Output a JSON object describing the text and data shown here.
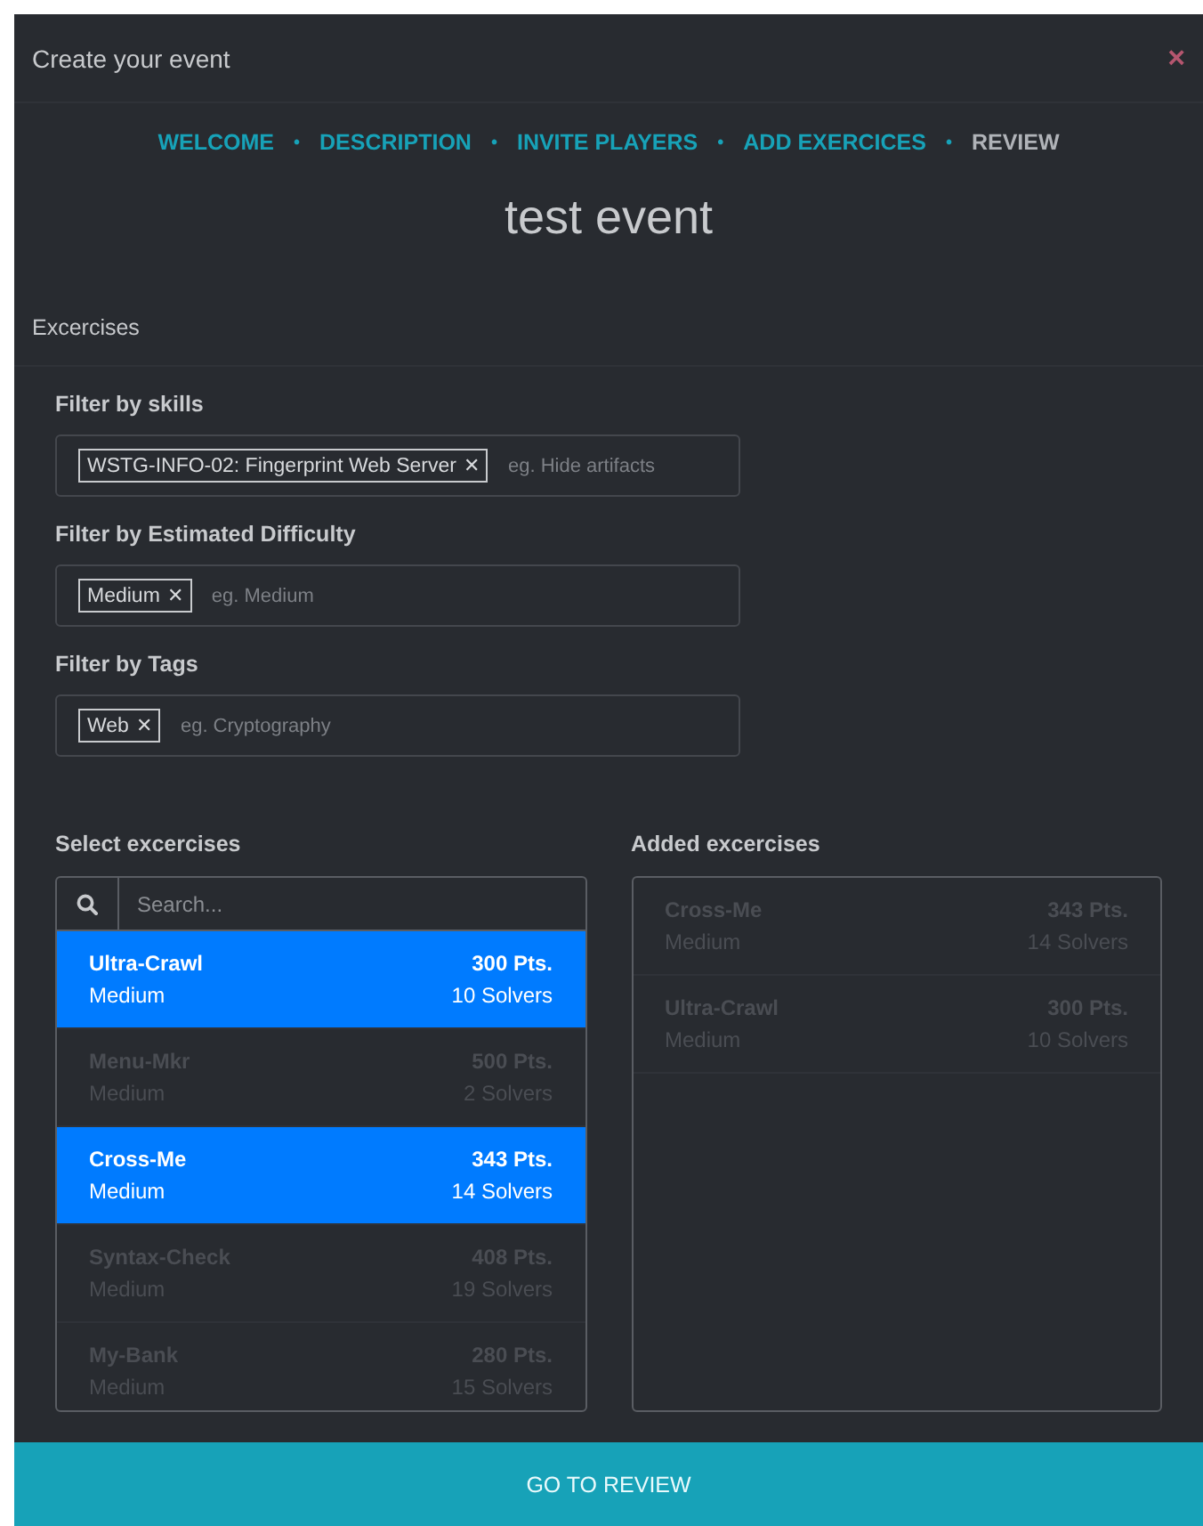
{
  "modal": {
    "title": "Create your event",
    "close": "×"
  },
  "steps": [
    {
      "label": "WELCOME",
      "enabled": true
    },
    {
      "label": "DESCRIPTION",
      "enabled": true
    },
    {
      "label": "INVITE PLAYERS",
      "enabled": true
    },
    {
      "label": "ADD EXERCICES",
      "enabled": true
    },
    {
      "label": "REVIEW",
      "enabled": false
    }
  ],
  "step_separator": "•",
  "event_name": "test event",
  "section_title": "Excercises",
  "filters": [
    {
      "label": "Filter by skills",
      "tags": [
        "WSTG-INFO-02: Fingerprint Web Server"
      ],
      "placeholder": "eg. Hide artifacts"
    },
    {
      "label": "Filter by Estimated Difficulty",
      "tags": [
        "Medium"
      ],
      "placeholder": "eg. Medium"
    },
    {
      "label": "Filter by Tags",
      "tags": [
        "Web"
      ],
      "placeholder": "eg. Cryptography"
    }
  ],
  "tag_remove": "✕",
  "select_list": {
    "label": "Select excercises",
    "search_placeholder": "Search...",
    "items": [
      {
        "name": "Ultra-Crawl",
        "points": "300 Pts.",
        "difficulty": "Medium",
        "solvers": "10 Solvers",
        "selected": true
      },
      {
        "name": "Menu-Mkr",
        "points": "500 Pts.",
        "difficulty": "Medium",
        "solvers": "2 Solvers",
        "selected": false
      },
      {
        "name": "Cross-Me",
        "points": "343 Pts.",
        "difficulty": "Medium",
        "solvers": "14 Solvers",
        "selected": true
      },
      {
        "name": "Syntax-Check",
        "points": "408 Pts.",
        "difficulty": "Medium",
        "solvers": "19 Solvers",
        "selected": false
      },
      {
        "name": "My-Bank",
        "points": "280 Pts.",
        "difficulty": "Medium",
        "solvers": "15 Solvers",
        "selected": false
      }
    ]
  },
  "added_list": {
    "label": "Added excercises",
    "items": [
      {
        "name": "Cross-Me",
        "points": "343 Pts.",
        "difficulty": "Medium",
        "solvers": "14 Solvers"
      },
      {
        "name": "Ultra-Crawl",
        "points": "300 Pts.",
        "difficulty": "Medium",
        "solvers": "10 Solvers"
      }
    ]
  },
  "primary_button": "GO TO REVIEW"
}
